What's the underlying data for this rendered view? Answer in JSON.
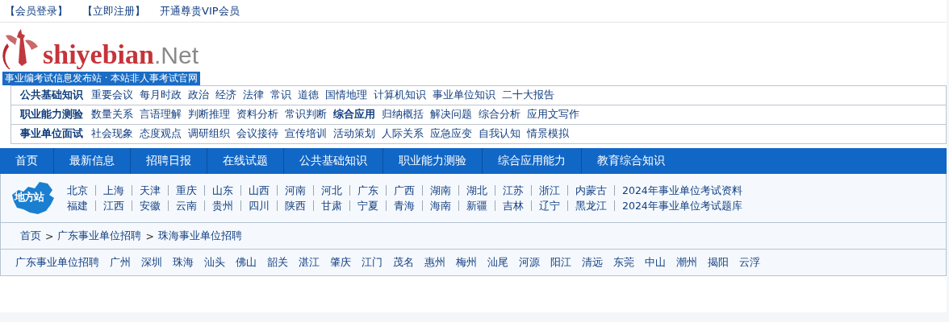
{
  "top_links": [
    "【会员登录】",
    "【立即注册】",
    "开通尊贵VIP会员"
  ],
  "logo": {
    "name": "shiyebian",
    "suffix": ".Net",
    "tagline": "事业编考试信息发布站 · 本站非人事考试官网"
  },
  "keyword_rows": [
    {
      "label": "公共基础知识",
      "items": [
        {
          "text": "重要会议",
          "bold": false
        },
        {
          "text": "每月时政",
          "bold": false
        },
        {
          "text": "政治",
          "bold": false
        },
        {
          "text": "经济",
          "bold": false
        },
        {
          "text": "法律",
          "bold": false
        },
        {
          "text": "常识",
          "bold": false
        },
        {
          "text": "道德",
          "bold": false
        },
        {
          "text": "国情地理",
          "bold": false
        },
        {
          "text": "计算机知识",
          "bold": false
        },
        {
          "text": "事业单位知识",
          "bold": false
        },
        {
          "text": "二十大报告",
          "bold": false
        }
      ]
    },
    {
      "label": "职业能力测验",
      "items": [
        {
          "text": "数量关系",
          "bold": false
        },
        {
          "text": "言语理解",
          "bold": false
        },
        {
          "text": "判断推理",
          "bold": false
        },
        {
          "text": "资料分析",
          "bold": false
        },
        {
          "text": "常识判断",
          "bold": false
        },
        {
          "text": "综合应用",
          "bold": true
        },
        {
          "text": "归纳概括",
          "bold": false
        },
        {
          "text": "解决问题",
          "bold": false
        },
        {
          "text": "综合分析",
          "bold": false
        },
        {
          "text": "应用文写作",
          "bold": false
        }
      ]
    },
    {
      "label": "事业单位面试",
      "items": [
        {
          "text": "社会现象",
          "bold": false
        },
        {
          "text": "态度观点",
          "bold": false
        },
        {
          "text": "调研组织",
          "bold": false
        },
        {
          "text": "会议接待",
          "bold": false
        },
        {
          "text": "宣传培训",
          "bold": false
        },
        {
          "text": "活动策划",
          "bold": false
        },
        {
          "text": "人际关系",
          "bold": false
        },
        {
          "text": "应急应变",
          "bold": false
        },
        {
          "text": "自我认知",
          "bold": false
        },
        {
          "text": "情景模拟",
          "bold": false
        }
      ]
    }
  ],
  "nav": [
    "首页",
    "最新信息",
    "招聘日报",
    "在线试题",
    "公共基础知识",
    "职业能力测验",
    "综合应用能力",
    "教育综合知识"
  ],
  "regions": {
    "badge": "地方站",
    "rows": [
      [
        "北京",
        "上海",
        "天津",
        "重庆",
        "山东",
        "山西",
        "河南",
        "河北",
        "广东",
        "广西",
        "湖南",
        "湖北",
        "江苏",
        "浙江",
        "内蒙古",
        "2024年事业单位考试资料"
      ],
      [
        "福建",
        "江西",
        "安徽",
        "云南",
        "贵州",
        "四川",
        "陕西",
        "甘肃",
        "宁夏",
        "青海",
        "海南",
        "新疆",
        "吉林",
        "辽宁",
        "黑龙江",
        "2024年事业单位考试题库"
      ]
    ]
  },
  "breadcrumb": {
    "items": [
      "首页",
      "广东事业单位招聘",
      "珠海事业单位招聘"
    ],
    "separators": [
      ">",
      ">"
    ]
  },
  "cities": [
    "广东事业单位招聘",
    "广州",
    "深圳",
    "珠海",
    "汕头",
    "佛山",
    "韶关",
    "湛江",
    "肇庆",
    "江门",
    "茂名",
    "惠州",
    "梅州",
    "汕尾",
    "河源",
    "阳江",
    "清远",
    "东莞",
    "中山",
    "潮州",
    "揭阳",
    "云浮"
  ]
}
